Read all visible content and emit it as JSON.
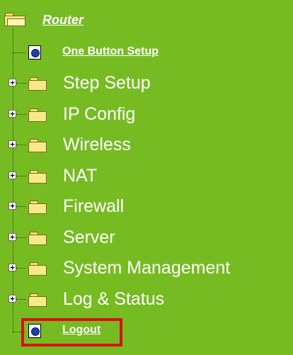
{
  "tree": {
    "root_label": "Router",
    "quick_link": "One Button Setup",
    "folders": [
      "Step Setup",
      "IP Config",
      "Wireless",
      "NAT",
      "Firewall",
      "Server",
      "System Management",
      "Log & Status"
    ],
    "logout": "Logout"
  },
  "colors": {
    "background": "#77bb22",
    "text": "#ffffff",
    "highlight": "#dd1111"
  }
}
